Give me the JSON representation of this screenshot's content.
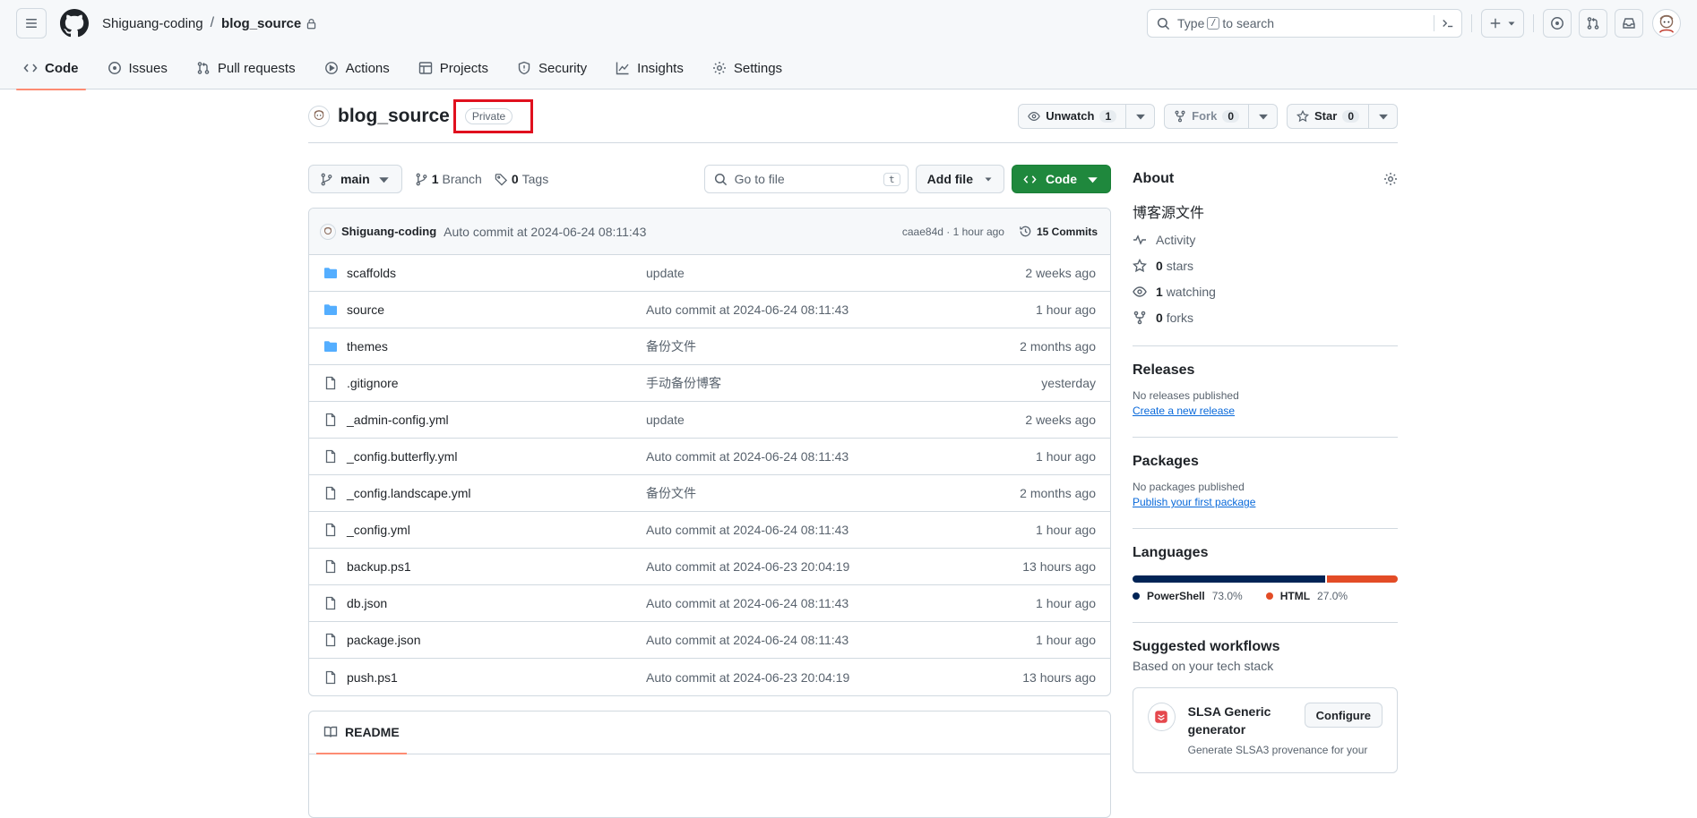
{
  "header": {
    "owner": "Shiguang-coding",
    "separator": "/",
    "repo": "blog_source",
    "search_prefix": "Type",
    "search_key": "/",
    "search_suffix": "to search"
  },
  "nav": {
    "tabs": [
      {
        "label": "Code",
        "icon": "code-icon"
      },
      {
        "label": "Issues",
        "icon": "issue-icon"
      },
      {
        "label": "Pull requests",
        "icon": "pull-request-icon"
      },
      {
        "label": "Actions",
        "icon": "play-icon"
      },
      {
        "label": "Projects",
        "icon": "table-icon"
      },
      {
        "label": "Security",
        "icon": "shield-icon"
      },
      {
        "label": "Insights",
        "icon": "graph-icon"
      },
      {
        "label": "Settings",
        "icon": "gear-icon"
      }
    ]
  },
  "repo": {
    "name": "blog_source",
    "visibility": "Private",
    "watch_label": "Unwatch",
    "watch_count": "1",
    "fork_label": "Fork",
    "fork_count": "0",
    "star_label": "Star",
    "star_count": "0"
  },
  "toolbar": {
    "branch": "main",
    "branch_count": "1",
    "branch_label": "Branch",
    "tag_count": "0",
    "tag_label": "Tags",
    "goto_placeholder": "Go to file",
    "goto_key": "t",
    "add_file": "Add file",
    "code": "Code"
  },
  "commit": {
    "author": "Shiguang-coding",
    "message": "Auto commit at 2024-06-24 08:11:43",
    "sha_time": "caae84d · 1 hour ago",
    "commits": "15 Commits"
  },
  "files": [
    {
      "type": "folder",
      "name": "scaffolds",
      "message": "update",
      "age": "2 weeks ago"
    },
    {
      "type": "folder",
      "name": "source",
      "message": "Auto commit at 2024-06-24 08:11:43",
      "age": "1 hour ago"
    },
    {
      "type": "folder",
      "name": "themes",
      "message": "备份文件",
      "age": "2 months ago"
    },
    {
      "type": "file",
      "name": ".gitignore",
      "message": "手动备份博客",
      "age": "yesterday"
    },
    {
      "type": "file",
      "name": "_admin-config.yml",
      "message": "update",
      "age": "2 weeks ago"
    },
    {
      "type": "file",
      "name": "_config.butterfly.yml",
      "message": "Auto commit at 2024-06-24 08:11:43",
      "age": "1 hour ago"
    },
    {
      "type": "file",
      "name": "_config.landscape.yml",
      "message": "备份文件",
      "age": "2 months ago"
    },
    {
      "type": "file",
      "name": "_config.yml",
      "message": "Auto commit at 2024-06-24 08:11:43",
      "age": "1 hour ago"
    },
    {
      "type": "file",
      "name": "backup.ps1",
      "message": "Auto commit at 2024-06-23 20:04:19",
      "age": "13 hours ago"
    },
    {
      "type": "file",
      "name": "db.json",
      "message": "Auto commit at 2024-06-24 08:11:43",
      "age": "1 hour ago"
    },
    {
      "type": "file",
      "name": "package.json",
      "message": "Auto commit at 2024-06-24 08:11:43",
      "age": "1 hour ago"
    },
    {
      "type": "file",
      "name": "push.ps1",
      "message": "Auto commit at 2024-06-23 20:04:19",
      "age": "13 hours ago"
    }
  ],
  "readme": {
    "tab": "README"
  },
  "about": {
    "title": "About",
    "description": "博客源文件",
    "activity": "Activity",
    "stars_count": "0",
    "stars_label": "stars",
    "watching_count": "1",
    "watching_label": "watching",
    "forks_count": "0",
    "forks_label": "forks"
  },
  "releases": {
    "title": "Releases",
    "note": "No releases published",
    "link": "Create a new release"
  },
  "packages": {
    "title": "Packages",
    "note": "No packages published",
    "link": "Publish your first package"
  },
  "languages": {
    "title": "Languages",
    "items": [
      {
        "name": "PowerShell",
        "pct": "73.0%",
        "share": 73.0,
        "color": "#012456"
      },
      {
        "name": "HTML",
        "pct": "27.0%",
        "share": 27.0,
        "color": "#e34c26"
      }
    ]
  },
  "workflows": {
    "title": "Suggested workflows",
    "subtitle": "Based on your tech stack",
    "card_name": "SLSA Generic generator",
    "card_desc": "Generate SLSA3 provenance for your",
    "card_button": "Configure"
  }
}
